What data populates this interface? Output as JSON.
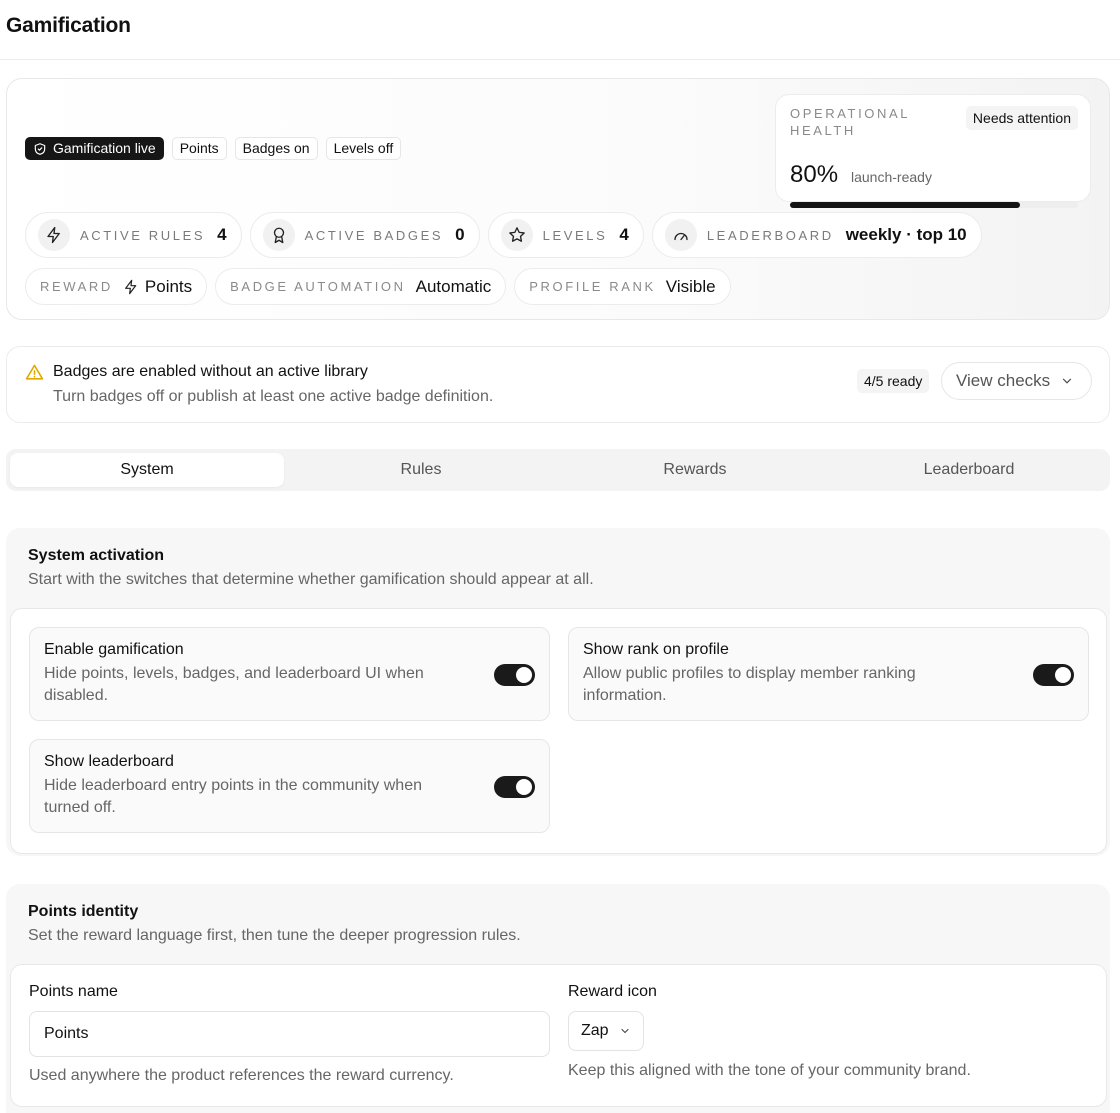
{
  "page": {
    "title": "Gamification"
  },
  "status": {
    "chips": [
      "Gamification live",
      "Points",
      "Badges on",
      "Levels off"
    ],
    "health": {
      "label": "OPERATIONAL HEALTH",
      "badge": "Needs attention",
      "percent": "80%",
      "note": "launch-ready",
      "progress": 0.8
    },
    "stats": [
      {
        "label": "ACTIVE RULES",
        "value": "4",
        "icon": "zap-icon"
      },
      {
        "label": "ACTIVE BADGES",
        "value": "0",
        "icon": "award-icon"
      },
      {
        "label": "LEVELS",
        "value": "4",
        "icon": "star-icon"
      },
      {
        "label": "LEADERBOARD",
        "value": "weekly · top 10",
        "icon": "gauge-icon"
      }
    ],
    "meta": [
      {
        "label": "REWARD",
        "value": "Points",
        "icon": "zap-icon"
      },
      {
        "label": "BADGE AUTOMATION",
        "value": "Automatic"
      },
      {
        "label": "PROFILE RANK",
        "value": "Visible"
      }
    ]
  },
  "alert": {
    "title": "Badges are enabled without an active library",
    "description": "Turn badges off or publish at least one active badge definition.",
    "ready": "4/5 ready",
    "button": "View checks"
  },
  "tabs": [
    {
      "label": "System",
      "active": true
    },
    {
      "label": "Rules",
      "active": false
    },
    {
      "label": "Rewards",
      "active": false
    },
    {
      "label": "Leaderboard",
      "active": false
    }
  ],
  "system_activation": {
    "title": "System activation",
    "description": "Start with the switches that determine whether gamification should appear at all.",
    "toggles": [
      {
        "title": "Enable gamification",
        "description": "Hide points, levels, badges, and leaderboard UI when disabled.",
        "on": true
      },
      {
        "title": "Show rank on profile",
        "description": "Allow public profiles to display member ranking information.",
        "on": true
      },
      {
        "title": "Show leaderboard",
        "description": "Hide leaderboard entry points in the community when turned off.",
        "on": true
      }
    ]
  },
  "points_identity": {
    "title": "Points identity",
    "description": "Set the reward language first, then tune the deeper progression rules.",
    "points_name": {
      "label": "Points name",
      "value": "Points",
      "help": "Used anywhere the product references the reward currency."
    },
    "reward_icon": {
      "label": "Reward icon",
      "value": "Zap",
      "help": "Keep this aligned with the tone of your community brand."
    }
  },
  "colors": {
    "dark": "#161616",
    "muted": "#666666",
    "border": "#e8e8e8",
    "warning": "#e0a800"
  }
}
